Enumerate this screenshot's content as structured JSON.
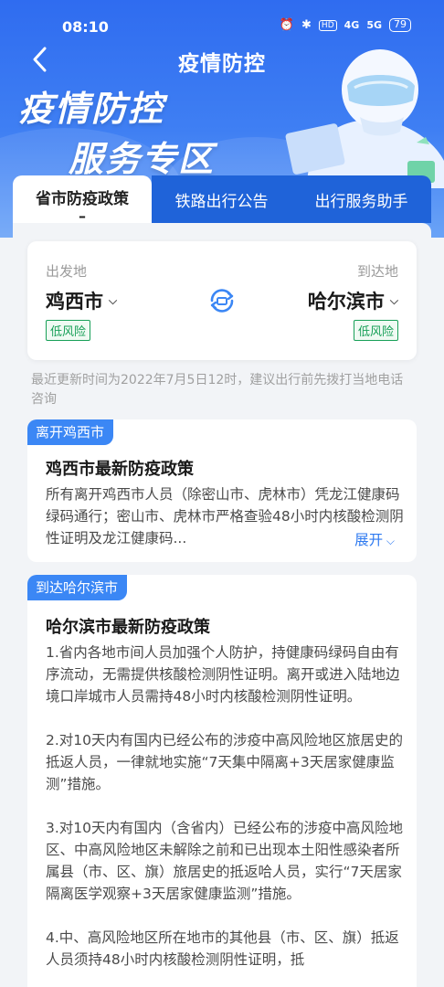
{
  "status_bar": {
    "time": "08:10",
    "signal_a": "4G",
    "signal_b": "5G",
    "battery": "79"
  },
  "nav": {
    "title": "疫情防控"
  },
  "banner": {
    "line1": "疫情防控",
    "line2": "服务专区"
  },
  "tabs": [
    {
      "label": "省市防疫政策",
      "indicator": "–"
    },
    {
      "label": "铁路出行公告"
    },
    {
      "label": "出行服务助手"
    }
  ],
  "route": {
    "from_label": "出发地",
    "from_city": "鸡西市",
    "from_risk": "低风险",
    "to_label": "到达地",
    "to_city": "哈尔滨市",
    "to_risk": "低风险"
  },
  "update_note": "最近更新时间为2022年7月5日12时，建议出行前先拨打当地电话咨询",
  "depart_card": {
    "tag": "离开鸡西市",
    "title": "鸡西市最新防疫政策",
    "body": "所有离开鸡西市人员（除密山市、虎林市）凭龙江健康码绿码通行；密山市、虎林市严格查验48小时内核酸检测阴性证明及龙江健康码...",
    "expand": "展开"
  },
  "arrive_card": {
    "tag": "到达哈尔滨市",
    "title": "哈尔滨市最新防疫政策",
    "body": "1.省内各地市间人员加强个人防护，持健康码绿码自由有序流动，无需提供核酸检测阴性证明。离开或进入陆地边境口岸城市人员需持48小时内核酸检测阴性证明。\n\n2.对10天内有国内已经公布的涉疫中高风险地区旅居史的抵返人员，一律就地实施“7天集中隔离+3天居家健康监测”措施。\n\n3.对10天内有国内（含省内）已经公布的涉疫中高风险地区、中高风险地区未解除之前和已出现本土阳性感染者所属县（市、区、旗）旅居史的抵返哈人员，实行“7天居家隔离医学观察+3天居家健康监测”措施。\n\n4.中、高风险地区所在地市的其他县（市、区、旗）抵返人员须持48小时内核酸检测阴性证明，抵"
  },
  "colors": {
    "primary": "#3b87f5",
    "risk_low": "#18a058"
  }
}
